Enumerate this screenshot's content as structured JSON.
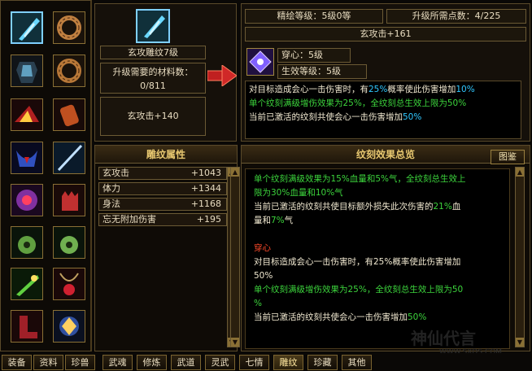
{
  "carving": {
    "name": "玄攻雕纹7级",
    "materials_label": "升级需要的材料数：",
    "materials_value": "0/811",
    "current_bonus": "玄攻击+140"
  },
  "upgrade": {
    "level_label": "精绘等级：5级0等",
    "points_label": "升级所需点数：4/225",
    "next_bonus": "玄攻击+161",
    "effect_name": "穿心：5级",
    "effect_level": "生效等级：5级",
    "desc_line1_a": "对目标造成会心一击伤害时，有",
    "desc_line1_pct": "25%",
    "desc_line1_b": "概率使此伤害增加",
    "desc_line1_pct2": "10%",
    "desc_line2": "单个纹刻满级增伤效果为25%，全纹刻总生效上限为50%",
    "desc_line3_a": "当前已激活的纹刻共使会心一击伤害增加",
    "desc_line3_pct": "50%"
  },
  "attributes": {
    "title": "雕纹属性",
    "rows": [
      {
        "name": "玄攻击",
        "value": "+1043"
      },
      {
        "name": "体力",
        "value": "+1344"
      },
      {
        "name": "身法",
        "value": "+1168"
      },
      {
        "name": "忘无附加伤害",
        "value": "+195"
      }
    ]
  },
  "effects": {
    "title": "纹刻效果总览",
    "gallery_button": "图鉴",
    "l1": "单个纹刻满级效果为15%血量和5%气，全纹刻总生效上",
    "l2": "限为30%血量和10%气",
    "l3a": "当前已激活的纹刻共使目标额外损失此次伤害的",
    "l3pct": "21%",
    "l3b": "血",
    "l4a": "量和",
    "l4pct": "7%",
    "l4b": "气",
    "section2": "穿心",
    "l5": "对目标造成会心一击伤害时，有25%概率使此伤害增加",
    "l6": "50%",
    "l7": "单个纹刻满级增伤效果为25%，全纹刻总生效上限为50",
    "l8": "%",
    "l9a": "当前已激活的纹刻共使会心一击伤害增加",
    "l9pct": "50%"
  },
  "tabs": [
    "装备",
    "资料",
    "珍兽",
    "武魂",
    "修炼",
    "武道",
    "灵武",
    "七情",
    "雕纹",
    "珍藏",
    "其他"
  ],
  "active_tab": "雕纹",
  "watermark": {
    "text": "神仙代言",
    "url": "WWW.SXDS.COM"
  },
  "colors": {
    "green": "#3cd43c",
    "highlight": "#30c8ff",
    "title_gold": "#e8c870",
    "red": "#ff4a2a"
  }
}
